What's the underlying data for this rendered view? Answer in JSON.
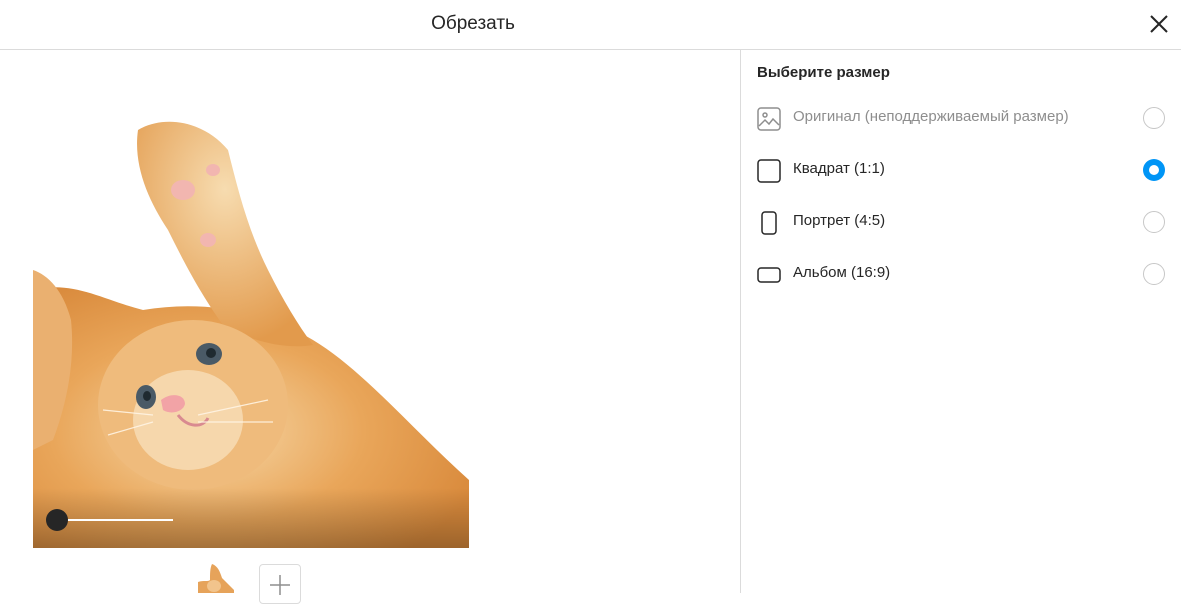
{
  "header": {
    "title": "Обрезать"
  },
  "editor": {
    "zoom": 0
  },
  "panel": {
    "title": "Выберите размер",
    "options": [
      {
        "label": "Оригинал (неподдерживаемый размер)",
        "icon": "image-icon",
        "selected": false,
        "disabled": true
      },
      {
        "label": "Квадрат (1:1)",
        "icon": "square-icon",
        "selected": true,
        "disabled": false
      },
      {
        "label": "Портрет (4:5)",
        "icon": "portrait-icon",
        "selected": false,
        "disabled": false
      },
      {
        "label": "Альбом (16:9)",
        "icon": "landscape-icon",
        "selected": false,
        "disabled": false
      }
    ]
  },
  "colors": {
    "accent": "#0095f6",
    "border": "#dbdbdb",
    "text": "#262626",
    "muted": "#8e8e8e"
  }
}
